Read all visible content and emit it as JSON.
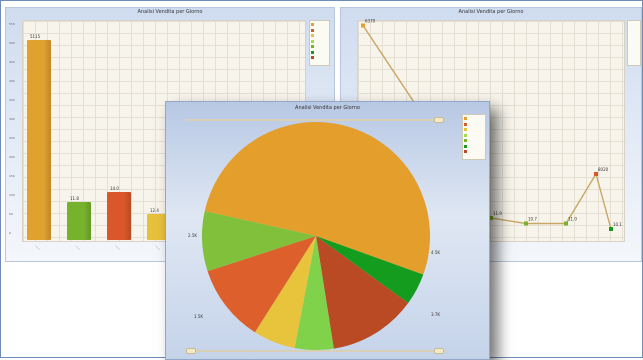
{
  "window": {
    "left_chart_title": "Analisi Vendita per Giorno",
    "right_chart_title": "Analisi Vendita per Giorno",
    "front_chart_title": "Analisi Vendita per Giorno"
  },
  "left_bar_chart": {
    "y_ticks": [
      "550",
      "500",
      "450",
      "400",
      "350",
      "300",
      "250",
      "200",
      "150",
      "100",
      "50",
      "0"
    ],
    "bars": [
      {
        "value_label": "5115",
        "color": "#e0a12e",
        "value": 500
      },
      {
        "value_label": "11.8",
        "color": "#76b22b",
        "value": 95
      },
      {
        "value_label": "14.0",
        "color": "#d9572b",
        "value": 120
      },
      {
        "value_label": "12.4",
        "color": "#e7c03c",
        "value": 65
      }
    ]
  },
  "right_line_chart": {
    "points": [
      {
        "label": "6370",
        "value": 390
      },
      {
        "label": "11.9",
        "value": 40
      },
      {
        "label": "10.7",
        "value": 30
      },
      {
        "label": "11.0",
        "value": 30
      },
      {
        "label": "8020",
        "value": 120
      },
      {
        "label": "10.1",
        "value": 20
      }
    ]
  },
  "pie_chart": {
    "slices": [
      {
        "name": "Orange",
        "value": 52,
        "color": "#e39e2c"
      },
      {
        "name": "Dark green",
        "value": 4.5,
        "color": "#149c1e"
      },
      {
        "name": "Brown-red",
        "value": 12.5,
        "color": "#b94a24"
      },
      {
        "name": "Light green",
        "value": 5.5,
        "color": "#7fd24a"
      },
      {
        "name": "Yellow",
        "value": 6,
        "color": "#e8c33c"
      },
      {
        "name": "Red-orange",
        "value": 11,
        "color": "#dd5f2c"
      },
      {
        "name": "Lime",
        "value": 8.5,
        "color": "#80c03a"
      }
    ],
    "labels": {
      "left_top": "2.5K",
      "right_mid": "4.5K",
      "left_bottom": "1.5K",
      "right_bottom": "3.7K"
    }
  },
  "legend": {
    "colors": [
      "#e0a12e",
      "#d9572b",
      "#e7c03c",
      "#a7d94a",
      "#76b22b",
      "#149c1e",
      "#b94a24"
    ]
  }
}
